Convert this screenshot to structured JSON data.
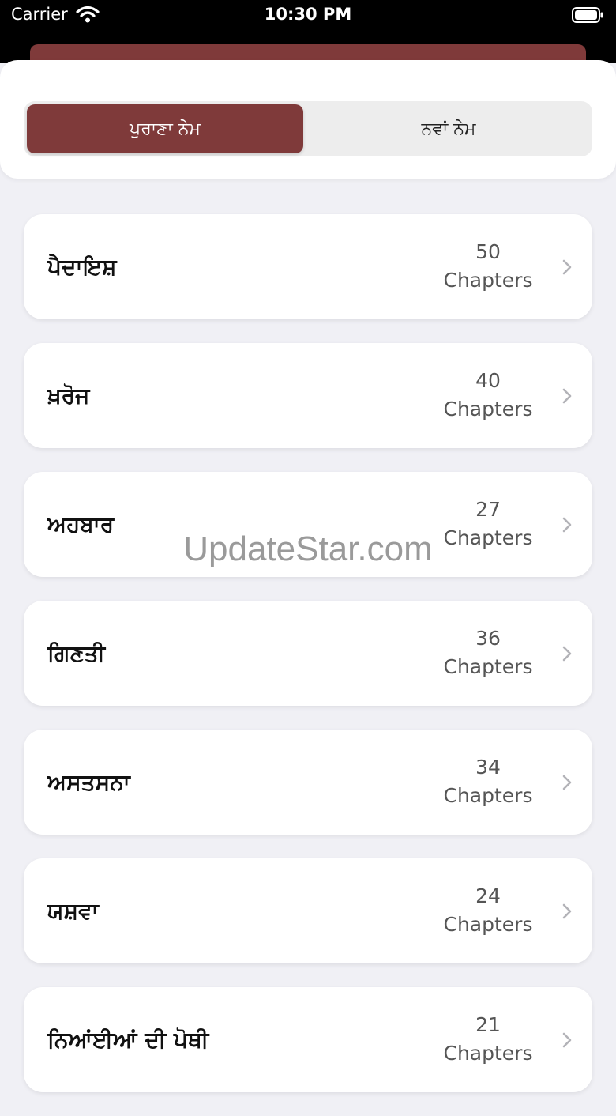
{
  "status_bar": {
    "carrier": "Carrier",
    "time": "10:30 PM",
    "icons": [
      "wifi-icon",
      "battery-icon"
    ]
  },
  "testament_switch": {
    "old_label": "ਪੁਰਾਣਾ ਨੇਮ",
    "new_label": "ਨਵਾਂ ਨੇਮ",
    "selected": "old"
  },
  "books": [
    {
      "title": "ਪੈਦਾਇਸ਼",
      "count": "50",
      "unit": "Chapters"
    },
    {
      "title": "ਖ਼ਰੋਜ",
      "count": "40",
      "unit": "Chapters"
    },
    {
      "title": "ਅਹਬਾਰ",
      "count": "27",
      "unit": "Chapters"
    },
    {
      "title": "ਗਿਣਤੀ",
      "count": "36",
      "unit": "Chapters"
    },
    {
      "title": "ਅਸਤਸਨਾ",
      "count": "34",
      "unit": "Chapters"
    },
    {
      "title": "ਯਸ਼ਵਾ",
      "count": "24",
      "unit": "Chapters"
    },
    {
      "title": "ਨਿਆਂਈਆਂ ਦੀ ਪੋਥੀ",
      "count": "21",
      "unit": "Chapters"
    }
  ],
  "watermark": "UpdateStar.com",
  "colors": {
    "accent": "#7f3a3a",
    "background": "#f0f0f5",
    "card": "#ffffff",
    "segment_bg": "#ededed",
    "muted_text": "#555555"
  }
}
